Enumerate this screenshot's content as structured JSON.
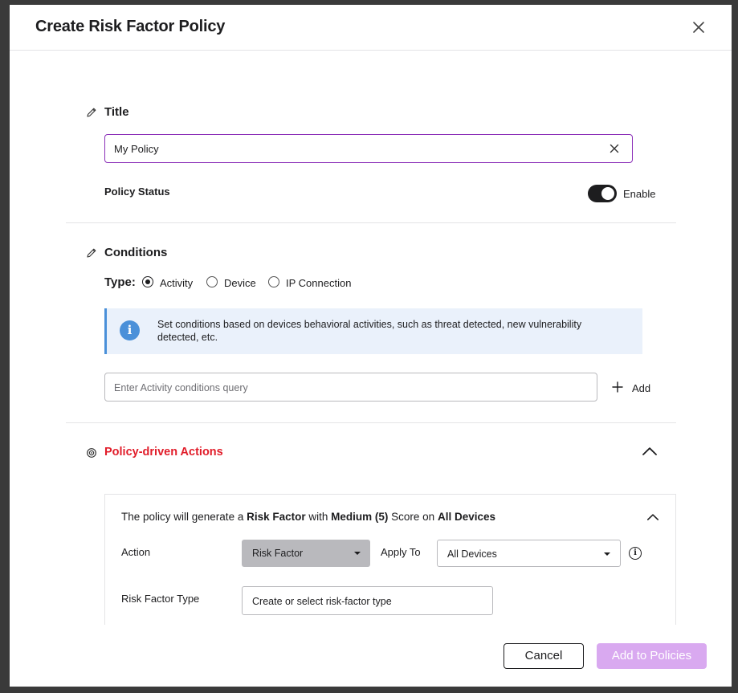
{
  "modal": {
    "title": "Create Risk Factor Policy"
  },
  "title_section": {
    "heading": "Title",
    "input_value": "My Policy",
    "policy_status_label": "Policy Status",
    "toggle_label": "Enable",
    "toggle_on": true
  },
  "conditions": {
    "heading": "Conditions",
    "type_label": "Type:",
    "types": [
      {
        "label": "Activity",
        "checked": true
      },
      {
        "label": "Device",
        "checked": false
      },
      {
        "label": "IP Connection",
        "checked": false
      }
    ],
    "info_text": "Set conditions based on devices behavioral activities, such as threat detected, new vulnerability detected, etc.",
    "query_placeholder": "Enter Activity conditions query",
    "add_label": "Add"
  },
  "actions": {
    "heading": "Policy-driven Actions",
    "summary": {
      "p1": "The policy will generate a ",
      "b1": "Risk Factor",
      "p2": " with ",
      "b2": "Medium (5)",
      "p3": " Score on ",
      "b3": "All Devices"
    },
    "action_label": "Action",
    "action_value": "Risk Factor",
    "apply_to_label": "Apply To",
    "apply_to_value": "All Devices",
    "risk_type_label": "Risk Factor Type",
    "risk_type_placeholder": "Create or select risk-factor type"
  },
  "footer": {
    "cancel_label": "Cancel",
    "submit_label": "Add to Policies"
  },
  "colors": {
    "accent_purple": "#8b2fb8",
    "disabled_primary": "#d9a9f0",
    "danger_red": "#e11d2a",
    "info_blue": "#4a90d9"
  }
}
